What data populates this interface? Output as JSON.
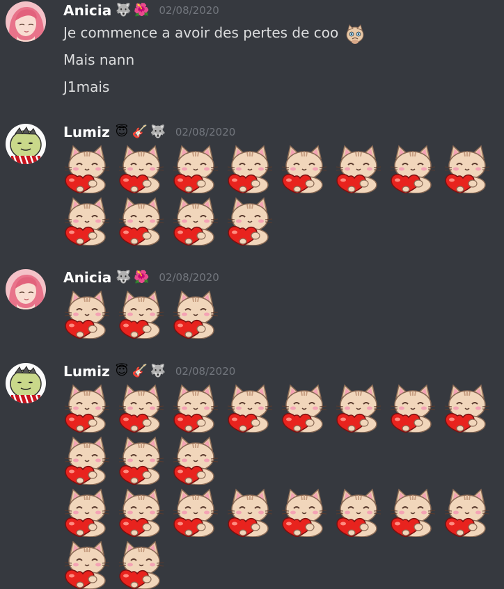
{
  "messages": [
    {
      "id": "m1",
      "author": "Anicia",
      "author_badges": [
        "wolf-icon",
        "hibiscus-icon"
      ],
      "timestamp": "02/08/2020",
      "avatar": "pink-hair-girl-avatar",
      "lines": [
        {
          "text": "Je commence a avoir des pertes de coo",
          "emoji": "worried-cat-icon"
        },
        {
          "text": "Mais nann"
        },
        {
          "text": "J1mais"
        }
      ]
    },
    {
      "id": "m2",
      "author": "Lumiz",
      "author_badges": [
        "angel-smile-icon",
        "guitar-icon",
        "wolf-icon"
      ],
      "timestamp": "02/08/2020",
      "avatar": "cartoon-face-avatar",
      "emoji_rows": [
        8,
        4
      ],
      "emoji": "cat-heart-icon"
    },
    {
      "id": "m3",
      "author": "Anicia",
      "author_badges": [
        "wolf-icon",
        "hibiscus-icon"
      ],
      "timestamp": "02/08/2020",
      "avatar": "pink-hair-girl-avatar",
      "emoji_rows": [
        3
      ],
      "emoji": "cat-heart-icon"
    },
    {
      "id": "m4",
      "author": "Lumiz",
      "author_badges": [
        "angel-smile-icon",
        "guitar-icon",
        "wolf-icon"
      ],
      "timestamp": "02/08/2020",
      "avatar": "cartoon-face-avatar",
      "emoji_rows": [
        8,
        3,
        8,
        2
      ],
      "emoji": "cat-heart-icon"
    }
  ],
  "colors": {
    "background": "#36393f",
    "username": "#ffffff",
    "message_text": "#dcddde",
    "timestamp": "#72767d"
  }
}
